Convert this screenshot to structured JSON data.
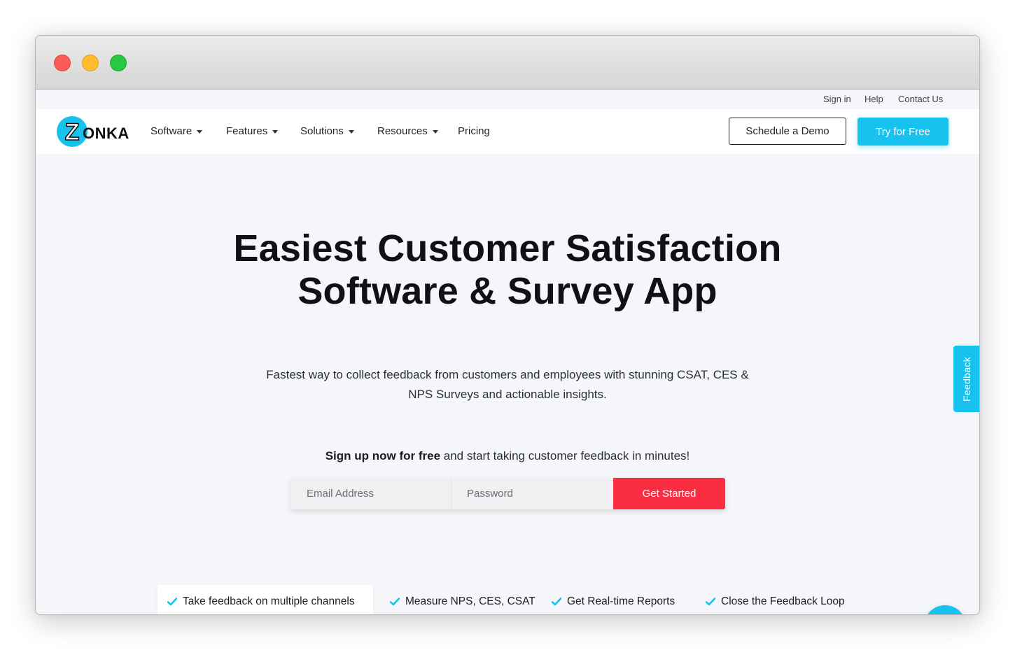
{
  "top_links": {
    "sign_in": "Sign in",
    "help": "Help",
    "contact": "Contact Us"
  },
  "logo": {
    "text": "ZONKA",
    "brand_color": "#17c3ee"
  },
  "nav": {
    "software": "Software",
    "features": "Features",
    "solutions": "Solutions",
    "resources": "Resources",
    "pricing": "Pricing"
  },
  "header_buttons": {
    "schedule_demo": "Schedule a Demo",
    "try_free": "Try for Free"
  },
  "hero": {
    "title_line1": "Easiest Customer Satisfaction",
    "title_line2": "Software & Survey App",
    "subtitle_line1": "Fastest way to collect feedback from customers and employees with stunning CSAT, CES &",
    "subtitle_line2": "NPS Surveys and actionable insights."
  },
  "signup": {
    "bold": "Sign up now for free",
    "rest": " and start taking customer feedback in minutes!",
    "email_placeholder": "Email Address",
    "password_placeholder": "Password",
    "button": "Get Started",
    "button_color": "#fb2d43"
  },
  "features": [
    {
      "label": "Take feedback on multiple channels"
    },
    {
      "label": "Measure NPS, CES, CSAT"
    },
    {
      "label": "Get Real-time Reports"
    },
    {
      "label": "Close the Feedback Loop"
    }
  ],
  "feedback_tab": "Feedback",
  "icons": {
    "check": "check-icon",
    "chat": "chat-icon",
    "caret": "chevron-down-icon"
  }
}
